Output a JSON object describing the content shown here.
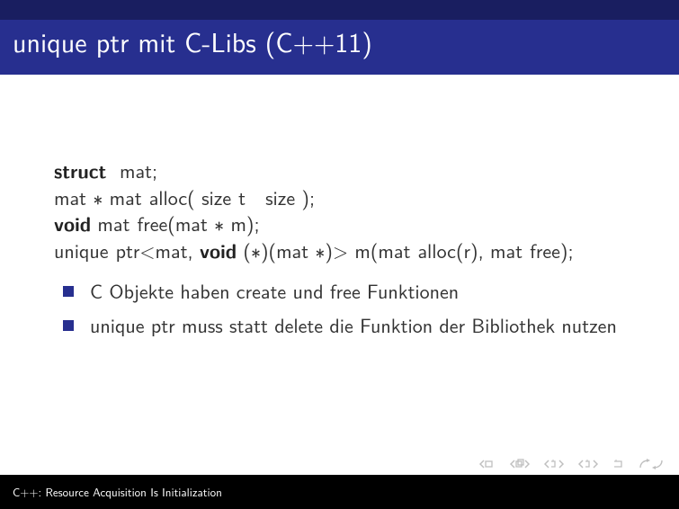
{
  "title_parts": [
    "unique",
    "ptr mit C-Libs (C++11)"
  ],
  "code": {
    "l1_kw": "struct",
    "l1_rest": "  mat;",
    "l2_a": "mat ∗ mat",
    "l2_b": "alloc( size",
    "l2_c": "t   size );",
    "l3_kw": "void",
    "l3_a": " mat",
    "l3_b": "free(mat ∗ m);",
    "l4_a": "unique",
    "l4_b": "ptr<mat, ",
    "l4_kw": "void",
    "l4_c": " (∗)(mat ∗)> m(mat",
    "l4_d": "alloc(r), mat",
    "l4_e": "free);"
  },
  "items": [
    "C Objekte haben create und free Funktionen",
    "unique ptr muss statt delete die Funktion der Bibliothek nutzen"
  ],
  "footer": "C++: Resource Acquisition Is Initialization",
  "chart_data": {
    "type": "table",
    "description": "Beamer presentation slide — no quantitative chart; content is C++ code and two bullet points.",
    "title": "unique_ptr mit C-Libs (C++11)",
    "code_lines": [
      "struct mat;",
      "mat * mat_alloc( size_t size );",
      "void mat_free(mat * m);",
      "unique_ptr<mat, void (*)(mat *)> m(mat_alloc(r), mat_free);"
    ],
    "bullets": [
      "C Objekte haben create und free Funktionen",
      "unique_ptr muss statt delete die Funktion der Bibliothek nutzen"
    ],
    "footer": "C++: Resource Acquisition Is Initialization"
  }
}
